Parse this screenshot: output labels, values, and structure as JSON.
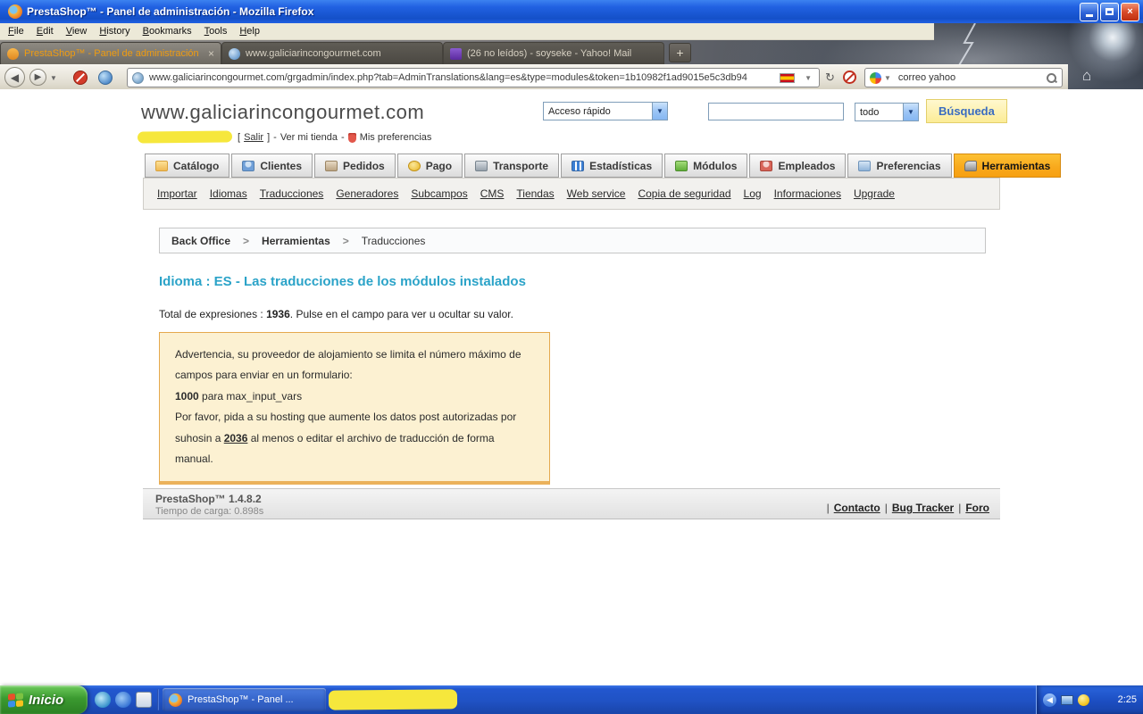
{
  "window": {
    "title": "PrestaShop™ - Panel de administración - Mozilla Firefox"
  },
  "menubar": {
    "items": [
      "File",
      "Edit",
      "View",
      "History",
      "Bookmarks",
      "Tools",
      "Help"
    ]
  },
  "tabstrip": {
    "tabs": [
      {
        "title": "PrestaShop™ - Panel de administración"
      },
      {
        "title": "www.galiciarincongourmet.com"
      },
      {
        "title": "(26 no leídos) - soyseke - Yahoo! Mail"
      }
    ],
    "close_glyph": "×",
    "new_tab": "+"
  },
  "navbar": {
    "url": "www.galiciarincongourmet.com/grgadmin/index.php?tab=AdminTranslations&lang=es&type=modules&token=1b10982f1ad9015e5c3db94",
    "search_value": "correo yahoo"
  },
  "page": {
    "site_title": "www.galiciarincongourmet.com",
    "header": {
      "quick_access": "Acceso rápido",
      "search_scope": "todo",
      "search_button": "Búsqueda"
    },
    "user_bar": {
      "bracket_l": "[",
      "salir": "Salir",
      "bracket_r": "]",
      "dash": "-",
      "view_store": "Ver mi tienda",
      "preferences": "Mis preferencias"
    },
    "main_tabs": [
      {
        "label": "Catálogo"
      },
      {
        "label": "Clientes"
      },
      {
        "label": "Pedidos"
      },
      {
        "label": "Pago"
      },
      {
        "label": "Transporte"
      },
      {
        "label": "Estadísticas"
      },
      {
        "label": "Módulos"
      },
      {
        "label": "Empleados"
      },
      {
        "label": "Preferencias"
      },
      {
        "label": "Herramientas"
      }
    ],
    "submenu": [
      "Importar",
      "Idiomas",
      "Traducciones",
      "Generadores",
      "Subcampos",
      "CMS",
      "Tiendas",
      "Web service",
      "Copia de seguridad",
      "Log",
      "Informaciones",
      "Upgrade"
    ],
    "breadcrumb": {
      "items": [
        "Back Office",
        "Herramientas",
        "Traducciones"
      ],
      "separator": ">"
    },
    "heading": "Idioma : ES - Las traducciones de los módulos instalados",
    "total": {
      "prefix": "Total de expresiones : ",
      "count": "1936",
      "suffix": ". Pulse en el campo para ver u ocultar su valor."
    },
    "warning": {
      "line1": "Advertencia, su proveedor de alojamiento se limita el número máximo de campos para enviar en un formulario:",
      "line2_value": "1000",
      "line2_rest": " para max_input_vars",
      "line3_pre": "Por favor, pida a su hosting que aumente los datos post autorizadas por suhosin a ",
      "line3_value": "2036",
      "line3_post": " al menos o editar el archivo de traducción de forma manual."
    },
    "footer": {
      "version": "PrestaShop™ 1.4.8.2",
      "load_time": "Tiempo de carga: 0.898s",
      "separator": "|",
      "links": [
        "Contacto",
        "Bug Tracker",
        "Foro"
      ]
    }
  },
  "taskbar": {
    "start": "Inicio",
    "task_button": "PrestaShop™ - Panel ...",
    "clock": "2:25"
  }
}
